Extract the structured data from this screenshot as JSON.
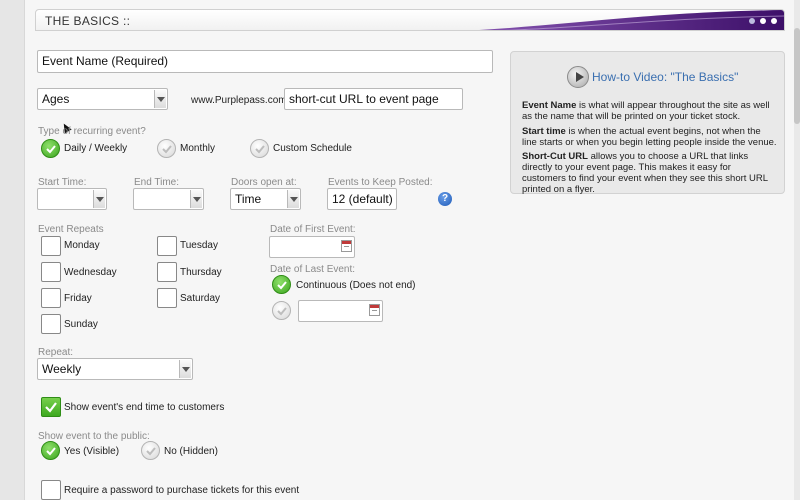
{
  "header": {
    "title": "THE BASICS ::"
  },
  "event_name": {
    "value": "Event Name (Required)"
  },
  "ages": {
    "selected": "Ages"
  },
  "url": {
    "prefix": "www.Purplepass.com/",
    "value": "short-cut URL to event page"
  },
  "recurring": {
    "label": "Type of recurring event?",
    "options": [
      {
        "label": "Daily / Weekly",
        "selected": true
      },
      {
        "label": "Monthly",
        "selected": false
      },
      {
        "label": "Custom Schedule",
        "selected": false
      }
    ]
  },
  "times": {
    "start_label": "Start Time:",
    "end_label": "End Time:",
    "doors_label": "Doors open at:",
    "doors_value": "Time",
    "keep_posted_label": "Events to Keep Posted:",
    "keep_posted_value": "12 (default)"
  },
  "repeats": {
    "label": "Event Repeats",
    "days": [
      "Monday",
      "Wednesday",
      "Friday",
      "Sunday",
      "Tuesday",
      "Thursday",
      "Saturday"
    ]
  },
  "dates": {
    "first_label": "Date of First Event:",
    "last_label": "Date of Last Event:",
    "continuous_label": "Continuous (Does not end)"
  },
  "repeat": {
    "label": "Repeat:",
    "selected": "Weekly"
  },
  "show_end_time": {
    "label": "Show event's end time to customers",
    "checked": true
  },
  "visibility": {
    "label": "Show event to the public:",
    "yes": "Yes (Visible)",
    "no": "No (Hidden)"
  },
  "password": {
    "label": "Require a password to purchase tickets for this event",
    "checked": false
  },
  "side_panel": {
    "video_title": "How-to Video: \"The Basics\"",
    "p1_bold": "Event Name",
    "p1_text": " is what will appear throughout the site as well as the name that will be printed on your ticket stock.",
    "p2_bold": "Start time",
    "p2_text": " is when the actual event begins, not when the line starts or when you begin letting people inside the venue.",
    "p3_bold": "Short-Cut URL",
    "p3_text": " allows you to choose a URL that links directly to your event page. This makes it easy for customers to find your event when they see this short URL printed on a flyer."
  },
  "colors": {
    "accent_purple": "#5a1f86",
    "link_blue": "#3a6fb0",
    "check_green": "#3ba41e"
  }
}
